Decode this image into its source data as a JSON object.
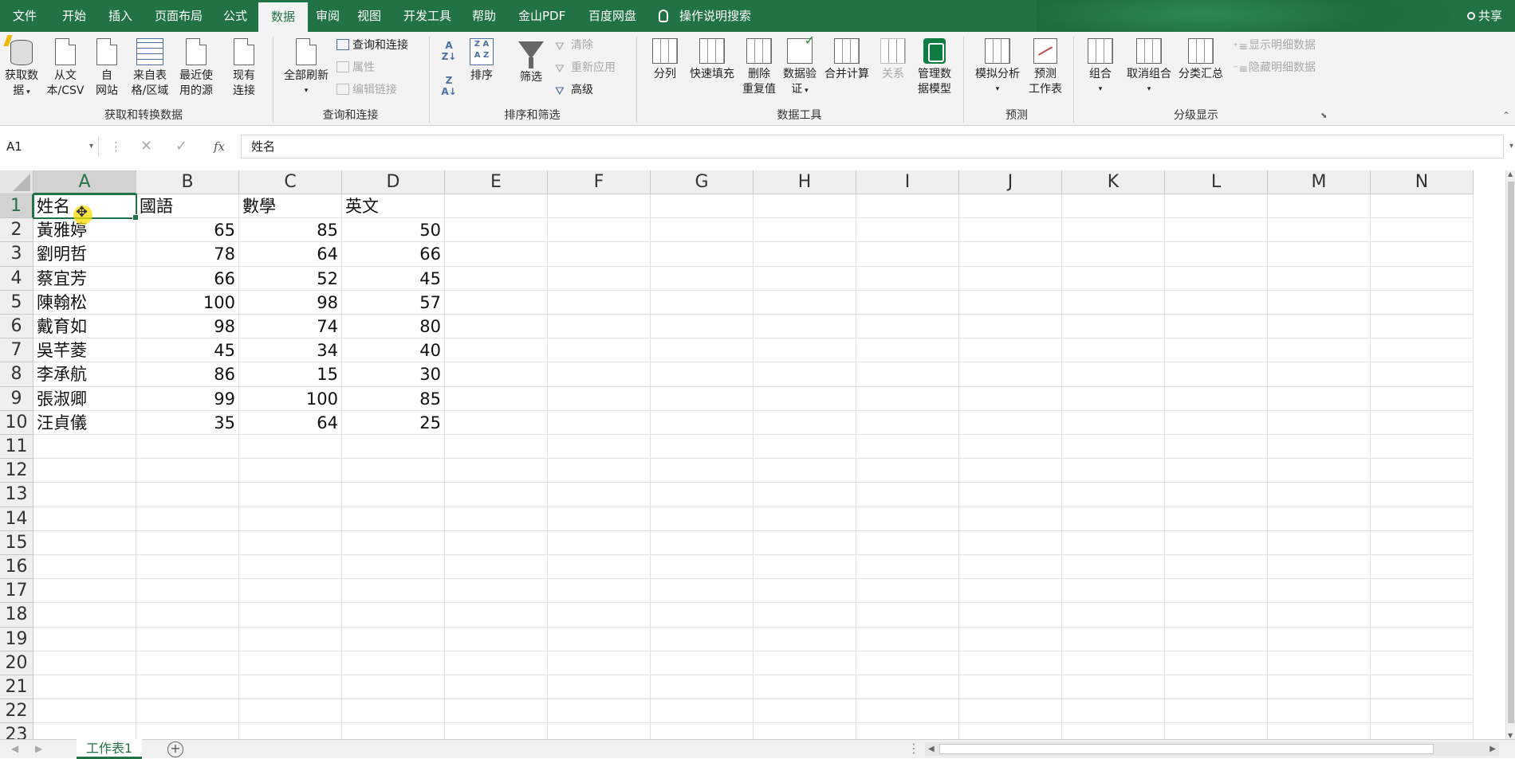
{
  "menu": {
    "items": [
      "文件",
      "开始",
      "插入",
      "页面布局",
      "公式",
      "数据",
      "审阅",
      "视图",
      "开发工具",
      "帮助",
      "金山PDF",
      "百度网盘"
    ],
    "active_index": 5,
    "tell_me": "操作说明搜索",
    "share": "共享"
  },
  "ribbon": {
    "get_data_line1": "获取数",
    "get_data_line2": "据",
    "from_text_line1": "从文",
    "from_text_line2": "本/CSV",
    "from_web_line1": "自",
    "from_web_line2": "网站",
    "from_table_line1": "来自表",
    "from_table_line2": "格/区域",
    "recent_line1": "最近使",
    "recent_line2": "用的源",
    "existing_line1": "现有",
    "existing_line2": "连接",
    "group_get": "获取和转换数据",
    "refresh_all": "全部刷新",
    "queries_conn": "查询和连接",
    "properties": "属性",
    "edit_links": "编辑链接",
    "group_queries": "查询和连接",
    "sort": "排序",
    "filter": "筛选",
    "clear": "清除",
    "reapply": "重新应用",
    "advanced": "高级",
    "group_sort": "排序和筛选",
    "text_to_columns": "分列",
    "flash_fill": "快速填充",
    "remove_dup_line1": "删除",
    "remove_dup_line2": "重复值",
    "validation_line1": "数据验",
    "validation_line2": "证",
    "consolidate": "合并计算",
    "relationships": "关系",
    "data_model_line1": "管理数",
    "data_model_line2": "据模型",
    "group_tools": "数据工具",
    "what_if": "模拟分析",
    "forecast_line1": "预测",
    "forecast_line2": "工作表",
    "group_forecast": "预测",
    "group_btn": "组合",
    "ungroup": "取消组合",
    "subtotal": "分类汇总",
    "show_detail": "显示明细数据",
    "hide_detail": "隐藏明细数据",
    "group_outline": "分级显示"
  },
  "formula_bar": {
    "name_box": "A1",
    "content": "姓名",
    "fx": "fx"
  },
  "grid": {
    "columns": [
      "A",
      "B",
      "C",
      "D",
      "E",
      "F",
      "G",
      "H",
      "I",
      "J",
      "K",
      "L",
      "M",
      "N"
    ],
    "rows": [
      "1",
      "2",
      "3",
      "4",
      "5",
      "6",
      "7",
      "8",
      "9",
      "10",
      "11",
      "12",
      "13",
      "14",
      "15",
      "16",
      "17",
      "18",
      "19",
      "20",
      "21",
      "22",
      "23"
    ],
    "header": [
      "姓名",
      "國語",
      "數學",
      "英文"
    ],
    "data": [
      [
        "黃雅婷",
        "65",
        "85",
        "50"
      ],
      [
        "劉明哲",
        "78",
        "64",
        "66"
      ],
      [
        "蔡宜芳",
        "66",
        "52",
        "45"
      ],
      [
        "陳翰松",
        "100",
        "98",
        "57"
      ],
      [
        "戴育如",
        "98",
        "74",
        "80"
      ],
      [
        "吳芊菱",
        "45",
        "34",
        "40"
      ],
      [
        "李承航",
        "86",
        "15",
        "30"
      ],
      [
        "張淑卿",
        "99",
        "100",
        "85"
      ],
      [
        "汪貞儀",
        "35",
        "64",
        "25"
      ]
    ],
    "active_cell": "A1"
  },
  "sheets": {
    "tabs": [
      "工作表1"
    ],
    "add": "+"
  },
  "colors": {
    "accent": "#217346",
    "header_bg": "#efefef",
    "gridline": "#e1e1e1"
  }
}
